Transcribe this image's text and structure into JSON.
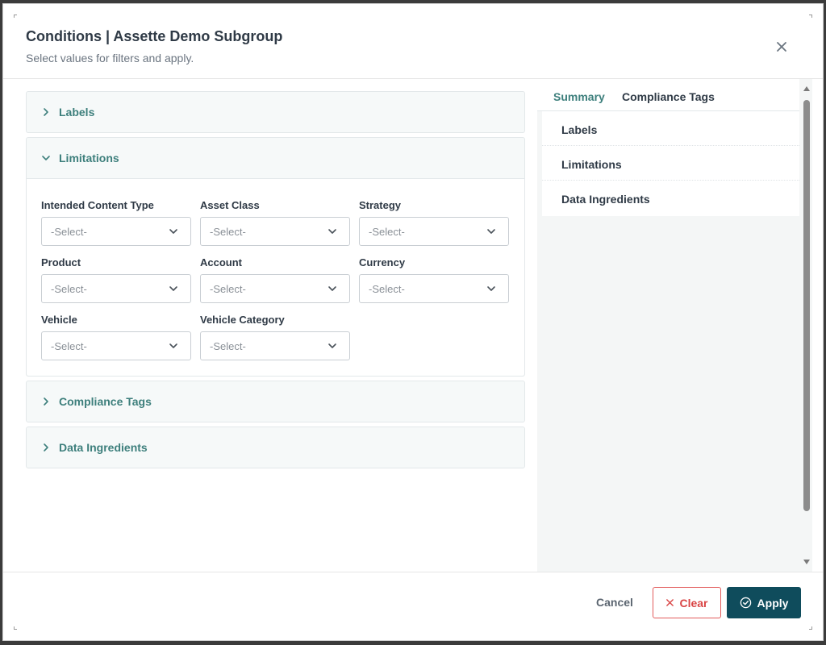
{
  "dialog": {
    "title": "Conditions | Assette Demo Subgroup",
    "subtitle": "Select values for filters and apply."
  },
  "sections": [
    {
      "label": "Labels",
      "expanded": false
    },
    {
      "label": "Limitations",
      "expanded": true
    },
    {
      "label": "Compliance Tags",
      "expanded": false
    },
    {
      "label": "Data Ingredients",
      "expanded": false
    }
  ],
  "limitations": {
    "fields": [
      {
        "label": "Intended Content Type",
        "placeholder": "-Select-"
      },
      {
        "label": "Asset Class",
        "placeholder": "-Select-"
      },
      {
        "label": "Strategy",
        "placeholder": "-Select-"
      },
      {
        "label": "Product",
        "placeholder": "-Select-"
      },
      {
        "label": "Account",
        "placeholder": "-Select-"
      },
      {
        "label": "Currency",
        "placeholder": "-Select-"
      },
      {
        "label": "Vehicle",
        "placeholder": "-Select-"
      },
      {
        "label": "Vehicle Category",
        "placeholder": "-Select-"
      }
    ]
  },
  "summary": {
    "tabs": [
      {
        "label": "Summary",
        "active": true
      },
      {
        "label": "Compliance Tags",
        "active": false
      }
    ],
    "items": [
      "Labels",
      "Limitations",
      "Data Ingredients"
    ]
  },
  "footer": {
    "cancel_label": "Cancel",
    "clear_label": "Clear",
    "apply_label": "Apply"
  },
  "colors": {
    "accent": "#3d7f7c",
    "primary_button": "#0f4c5c",
    "danger": "#d94444"
  }
}
